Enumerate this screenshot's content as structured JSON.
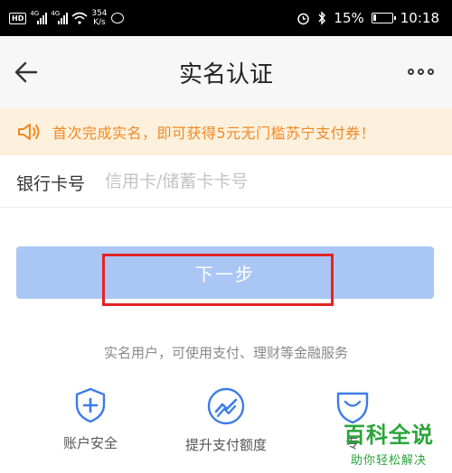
{
  "status_bar": {
    "hd": "HD",
    "net1": "4G",
    "net2": "4G",
    "speed_value": "354",
    "speed_unit": "K/s",
    "battery": "15%",
    "time": "10:18"
  },
  "header": {
    "title": "实名认证"
  },
  "notice": {
    "text": "首次完成实名，即可获得5元无门槛苏宁支付券！"
  },
  "form": {
    "card_label": "银行卡号",
    "card_placeholder": "信用卡/储蓄卡卡号",
    "card_value": ""
  },
  "next_button": {
    "label": "下一步"
  },
  "hint": {
    "text": "实名用户，可使用支付、理财等金融服务"
  },
  "features": [
    {
      "label": "账户安全",
      "icon": "shield-plus-icon"
    },
    {
      "label": "提升支付额度",
      "icon": "speed-up-icon"
    },
    {
      "label": "专",
      "icon": "gift-icon"
    }
  ],
  "watermark": {
    "title": "百科全说",
    "subtitle": "助你轻松解决"
  },
  "colors": {
    "accent": "#f08a24",
    "notice_bg": "#fdf0dd",
    "button": "#a9c6f5",
    "icon_blue": "#3d7ce6",
    "highlight": "#e32424",
    "watermark": "#2aa53a"
  }
}
